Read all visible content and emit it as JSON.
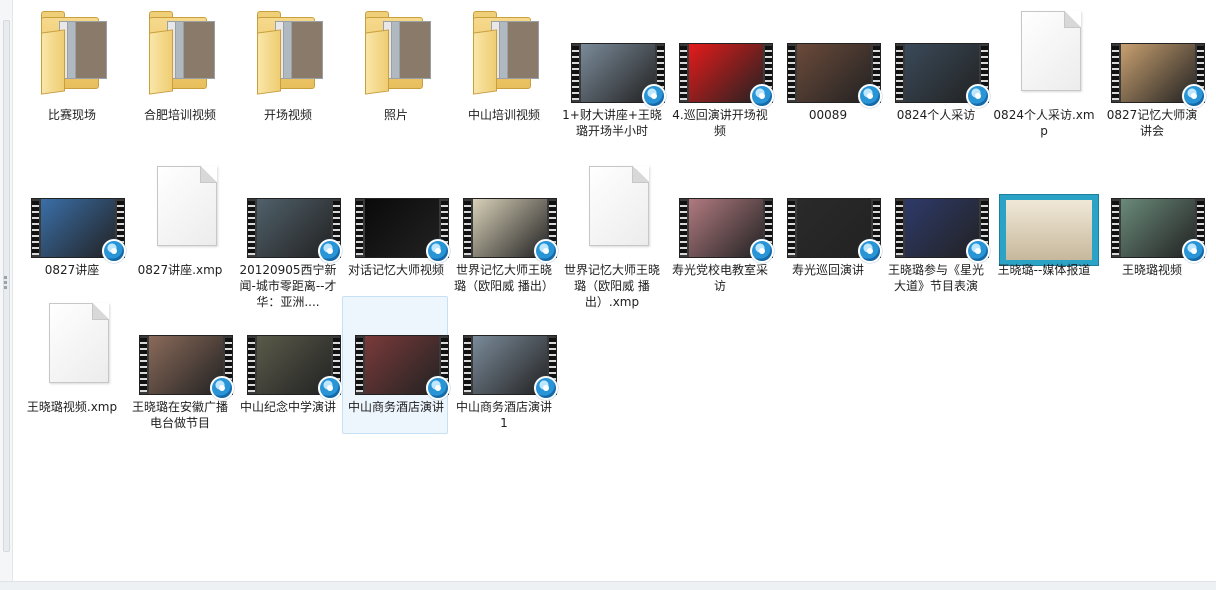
{
  "items": [
    {
      "label": "比赛现场",
      "kind": "folder"
    },
    {
      "label": "合肥培训视频",
      "kind": "folder"
    },
    {
      "label": "开场视频",
      "kind": "folder"
    },
    {
      "label": "照片",
      "kind": "folder"
    },
    {
      "label": "中山培训视频",
      "kind": "folder"
    },
    {
      "label": "1+财大讲座+王晓璐开场半小时",
      "kind": "video"
    },
    {
      "label": "4.巡回演讲开场视频",
      "kind": "video"
    },
    {
      "label": "00089",
      "kind": "video"
    },
    {
      "label": "0824个人采访",
      "kind": "video"
    },
    {
      "label": "0824个人采访.xmp",
      "kind": "file"
    },
    {
      "label": "0827记忆大师演讲会",
      "kind": "video"
    },
    {
      "label": "0827讲座",
      "kind": "video"
    },
    {
      "label": "0827讲座.xmp",
      "kind": "file"
    },
    {
      "label": "20120905西宁新闻-城市零距离--才华：亚洲....",
      "kind": "video"
    },
    {
      "label": "对话记忆大师视频",
      "kind": "video"
    },
    {
      "label": "世界记忆大师王晓璐（欧阳威 播出）",
      "kind": "video"
    },
    {
      "label": "世界记忆大师王晓璐（欧阳威 播出）.xmp",
      "kind": "file"
    },
    {
      "label": "寿光党校电教室采访",
      "kind": "video"
    },
    {
      "label": "寿光巡回演讲",
      "kind": "video"
    },
    {
      "label": "王晓璐参与《星光大道》节目表演",
      "kind": "video"
    },
    {
      "label": "王晓璐--媒体报道",
      "kind": "image"
    },
    {
      "label": "王晓璐视频",
      "kind": "video"
    },
    {
      "label": "王晓璐视频.xmp",
      "kind": "file"
    },
    {
      "label": "王晓璐在安徽广播电台做节目",
      "kind": "video"
    },
    {
      "label": "中山纪念中学演讲",
      "kind": "video"
    },
    {
      "label": "中山商务酒店演讲",
      "kind": "video",
      "selected": true
    },
    {
      "label": "中山商务酒店演讲1",
      "kind": "video"
    }
  ],
  "video_frame_colors": [
    "#7a8a99",
    "#e41b1b",
    "#6b4a3a",
    "#3a4a5a",
    "#c8a070",
    "#3a6fa8",
    "#50606a",
    "#0a0a0a",
    "#d8d0b8",
    "#b07a80",
    "#2a2a2a",
    "#2e3a6a",
    "#6a8a7a",
    "#8a6a5a",
    "#5a5a4a",
    "#7a3a3a"
  ]
}
